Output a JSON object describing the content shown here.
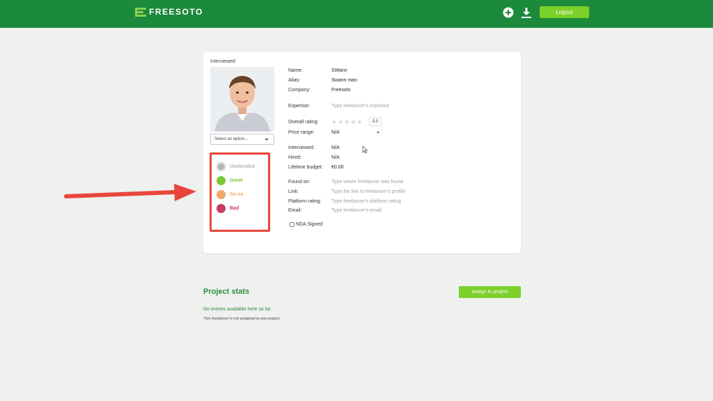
{
  "header": {
    "brand": "FREESOTO",
    "logout_label": "Logout",
    "icons": [
      "plus-circle-icon",
      "download-icon"
    ]
  },
  "profile": {
    "status_title": "Interviewed",
    "select_placeholder": "Select an option...",
    "rating_options": [
      {
        "label": "Undecided",
        "color": "#b5b5b5"
      },
      {
        "label": "Great",
        "color": "#7cc63a"
      },
      {
        "label": "So-so",
        "color": "#f0a968"
      },
      {
        "label": "Bad",
        "color": "#c93a5d"
      }
    ]
  },
  "details": {
    "name_label": "Name:",
    "name_value": "SWann",
    "alias_label": "Alias:",
    "alias_value": "Swann man",
    "company_label": "Company:",
    "company_value": "Freesoto",
    "expertise_label": "Expertise:",
    "expertise_placeholder": "Type freelancer's expertise",
    "overall_rating_label": "Overall rating:",
    "overall_rating_value": "0.0",
    "price_range_label": "Price range:",
    "price_range_value": "N/A",
    "interviewed_label": "Interviewed:",
    "interviewed_value": "N/A",
    "hired_label": "Hired:",
    "hired_value": "N/A",
    "lifetime_budget_label": "Lifetime budget:",
    "lifetime_budget_value": "€0.00",
    "found_on_label": "Found on:",
    "found_on_placeholder": "Type where freelancer was found",
    "link_label": "Link:",
    "link_placeholder": "Type the link to freelancer's profile",
    "platform_rating_label": "Platform rating:",
    "platform_rating_placeholder": "Type freelancer's platform rating",
    "email_label": "Email:",
    "email_placeholder": "Type freelancer's email",
    "nda_label": "NDA Signed"
  },
  "project_stats": {
    "title": "Project stats",
    "assign_label": "Assign to project",
    "empty_text": "No entries available here so far.",
    "not_assigned_text": "This freelancer is not assigned to any project."
  },
  "colors": {
    "header_bg": "#1b8a3c",
    "accent_button": "#7cd02a",
    "highlight_red": "#e8463d"
  }
}
